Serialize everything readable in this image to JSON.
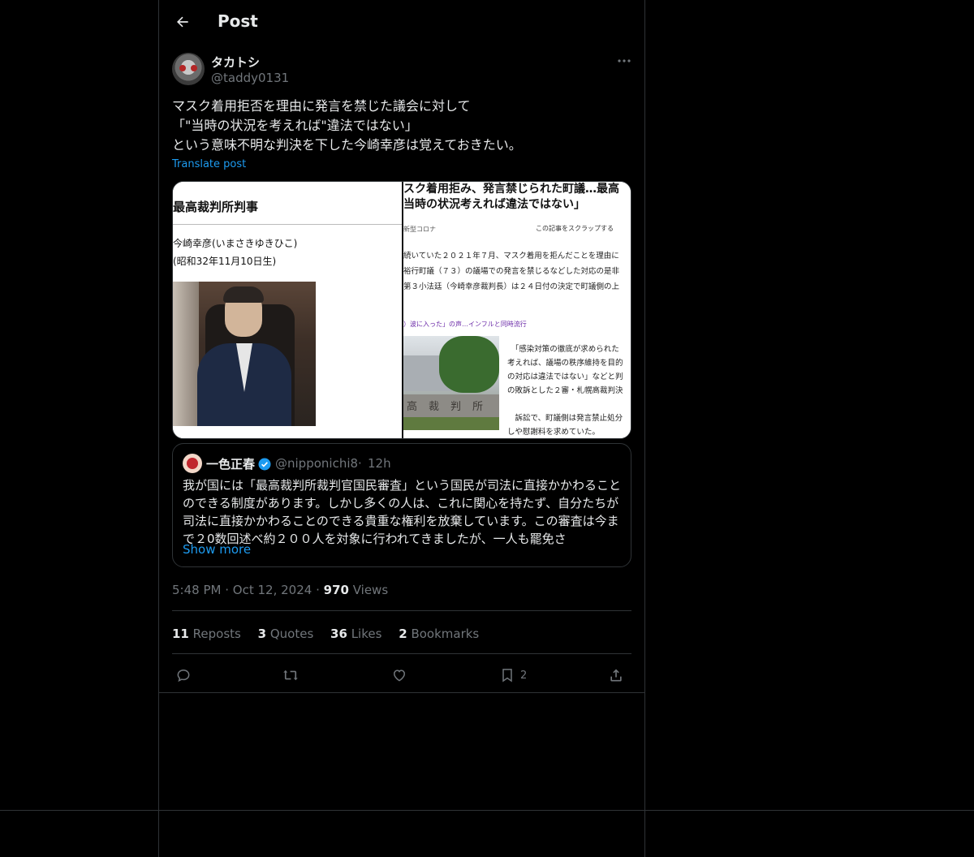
{
  "header": {
    "title": "Post"
  },
  "author": {
    "name": "タカトシ",
    "handle": "@taddy0131"
  },
  "post": {
    "text": "マスク着用拒否を理由に発言を禁じた議会に対して\n「\"当時の状況を考えれば\"違法ではない」\nという意味不明な判決を下した今崎幸彦は覚えておきたい。",
    "translate_label": "Translate post"
  },
  "media": {
    "left": {
      "title": "最高裁判所判事",
      "name": "今崎幸彦(いまさきゆきひこ)",
      "birth": "(昭和32年11月10日生)"
    },
    "right": {
      "headline": "スク着用拒み、発言禁じられた町議…最高\n当時の状況考えれば違法ではない」",
      "category": "新型コロナ",
      "scrap": "この記事をスクラップする",
      "paragraph": "続いていた２０２１年７月、マスク着用を拒んだことを理由に\n裕行町議（７３）の議場での発言を禁じるなどした対応の是非\n第３小法廷（今崎幸彦裁判長）は２４日付の決定で町議側の上",
      "link": "）波に入った」の声…インフルと同時流行",
      "engraving": "高裁判所",
      "quote": "　「感染対策の徹底が求められた\n考えれば、議場の秩序維持を目的\nの対応は違法ではない」などと判\nの敗訴とした２審・札幌高裁判決",
      "last": "　訴訟で、町議側は発言禁止処分\nしや慰謝料を求めていた。"
    }
  },
  "quote": {
    "name": "一色正春",
    "handle": "@nipponichi8",
    "separator": "·",
    "time": "12h",
    "text": "我が国には「最高裁判所裁判官国民審査」という国民が司法に直接かかわることのできる制度があります。しかし多くの人は、これに関心を持たず、自分たちが司法に直接かかわることのできる貴重な権利を放棄しています。この審査は今まで２0数回述べ約２００人を対象に行われてきましたが、一人も罷免さ",
    "show_more": "Show more"
  },
  "meta": {
    "time": "5:48 PM",
    "dot1": "·",
    "date": "Oct 12, 2024",
    "dot2": "·",
    "views_count": "970",
    "views_label": "Views"
  },
  "stats": [
    {
      "count": "11",
      "label": "Reposts"
    },
    {
      "count": "3",
      "label": "Quotes"
    },
    {
      "count": "36",
      "label": "Likes"
    },
    {
      "count": "2",
      "label": "Bookmarks"
    }
  ],
  "actions": {
    "bookmark_count": "2"
  },
  "colors": {
    "accent": "#1d9bf0",
    "muted": "#71767b",
    "border": "#2f3336",
    "text": "#e7e9ea"
  },
  "icons": {
    "back": "arrow-left-icon",
    "more": "more-horizontal-icon",
    "verified": "verified-badge-icon",
    "reply": "reply-icon",
    "repost": "repost-icon",
    "like": "heart-icon",
    "bookmark": "bookmark-icon",
    "share": "share-icon"
  }
}
